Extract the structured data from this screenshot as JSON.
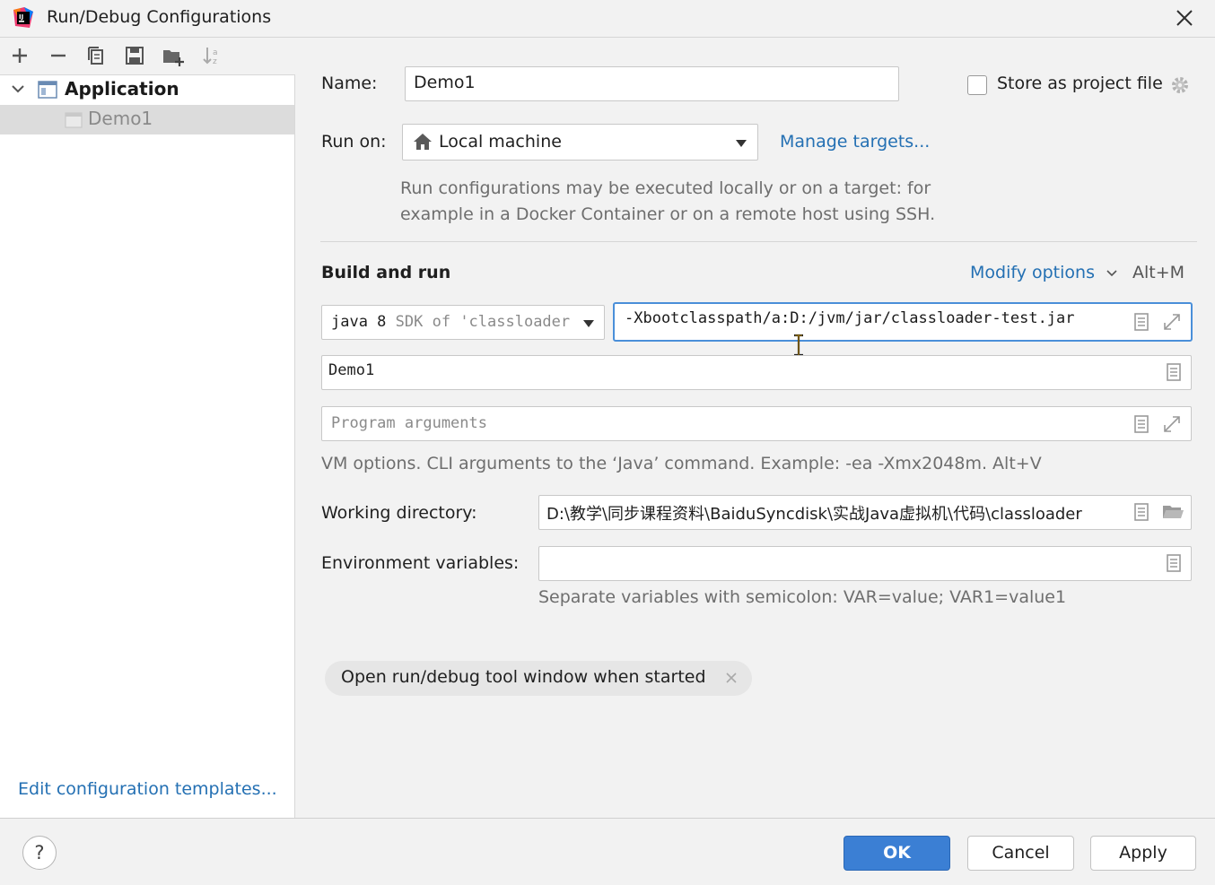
{
  "window": {
    "title": "Run/Debug Configurations"
  },
  "toolbar": {
    "icons": [
      "add-icon",
      "remove-icon",
      "copy-icon",
      "save-icon",
      "folder-add-icon",
      "sort-icon"
    ]
  },
  "tree": {
    "group_label": "Application",
    "item_label": "Demo1"
  },
  "left": {
    "edit_templates_link": "Edit configuration templates..."
  },
  "form": {
    "name_label": "Name:",
    "name_value": "Demo1",
    "store_label": "Store as project file",
    "store_checked": false,
    "run_on_label": "Run on:",
    "run_on_value": "Local machine",
    "manage_targets_link": "Manage targets...",
    "run_on_hint_line1": "Run configurations may be executed locally or on a target: for",
    "run_on_hint_line2": "example in a Docker Container or on a remote host using SSH.",
    "build_run_title": "Build and run",
    "modify_options_link": "Modify options",
    "modify_options_shortcut": "Alt+M",
    "jdk_main": "java 8",
    "jdk_detail": "SDK of 'classloader",
    "vm_options_value": "-Xbootclasspath/a:D:/jvm/jar/classloader-test.jar",
    "main_class_value": "Demo1",
    "program_args_placeholder": "Program arguments",
    "vm_hint": "VM options. CLI arguments to the ‘Java’ command. Example: -ea -Xmx2048m. Alt+V",
    "working_dir_label": "Working directory:",
    "working_dir_value": "D:\\教学\\同步课程资料\\BaiduSyncdisk\\实战Java虚拟机\\代码\\classloader",
    "env_label": "Environment variables:",
    "env_value": "",
    "env_hint": "Separate variables with semicolon: VAR=value; VAR1=value1",
    "chip_label": "Open run/debug tool window when started"
  },
  "buttons": {
    "help": "?",
    "ok": "OK",
    "cancel": "Cancel",
    "apply": "Apply"
  },
  "colors": {
    "accent": "#3b7fd4",
    "link": "#2470b3",
    "focus_border": "#4a8fd9"
  }
}
